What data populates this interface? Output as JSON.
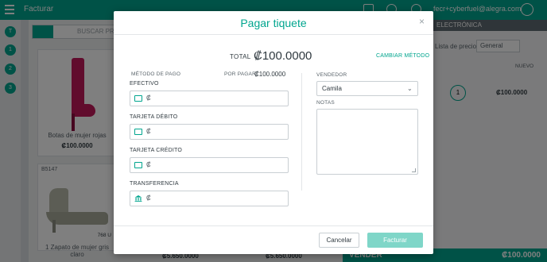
{
  "app": {
    "title": "Facturar",
    "user_email": "fecr+cyberfuel@alegra.com",
    "rail_items": [
      "T",
      "1",
      "2",
      "3"
    ],
    "search_placeholder": "BUSCAR PR..."
  },
  "catalog": {
    "products": [
      {
        "name": "Botas de mujer rojas",
        "price": "₡100.0000",
        "sku": ""
      },
      {
        "name": "1 Zapato de mujer gris claro",
        "price": "",
        "sku": "B5147",
        "stock": "768 U"
      }
    ],
    "bottom_prices": [
      "₡5.650.0000",
      "₡5.650.0000"
    ]
  },
  "side_panel": {
    "header": "ELECTRÓNICA",
    "price_list_label": "Lista de precios",
    "price_list_value": "General",
    "new_label": "NUEVO",
    "quantity": "1",
    "line_price": "₡100.0000",
    "sell_label": "VENDER",
    "sell_total": "₡100.0000"
  },
  "modal": {
    "title": "Pagar tiquete",
    "close_glyph": "×",
    "total_label": "TOTAL",
    "total_value": "₡100.0000",
    "change_method": "CAMBIAR MÉTODO",
    "method_label": "MÉTODO DE PAGO",
    "due_label": "POR PAGAR",
    "due_value": "₡100.0000",
    "currency_symbol": "₡",
    "payment_fields": [
      {
        "label": "EFECTIVO",
        "icon": "cash-icon",
        "value": ""
      },
      {
        "label": "TARJETA DÉBITO",
        "icon": "card-icon",
        "value": ""
      },
      {
        "label": "TARJETA CRÉDITO",
        "icon": "card-icon",
        "value": ""
      },
      {
        "label": "TRANSFERENCIA",
        "icon": "bank-icon",
        "value": ""
      }
    ],
    "seller_label": "VENDEDOR",
    "seller_value": "Camila",
    "notes_label": "NOTAS",
    "notes_value": "",
    "cancel_label": "Cancelar",
    "submit_label": "Facturar"
  },
  "colors": {
    "brand": "#00a58e",
    "brand_disabled": "#7fd6c8",
    "text": "#303a40",
    "muted": "#59636a",
    "border": "#c9cfd3"
  }
}
